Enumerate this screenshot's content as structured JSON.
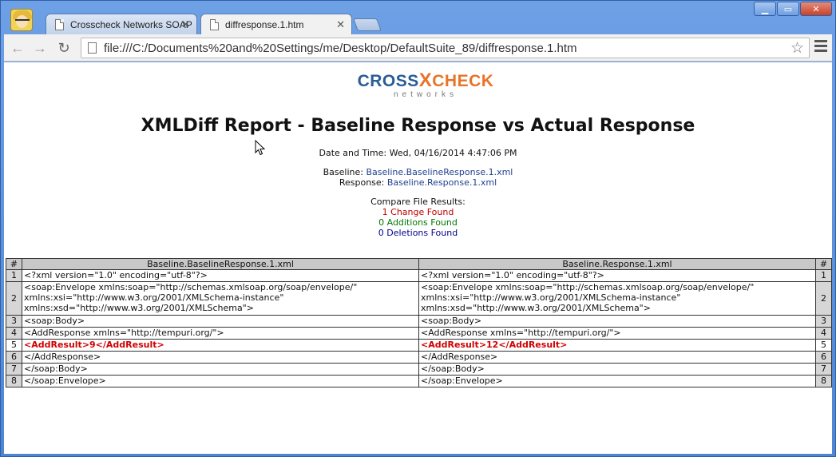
{
  "tabs": [
    {
      "label": "Crosscheck Networks SOAP",
      "active": false
    },
    {
      "label": "diffresponse.1.htm",
      "active": true
    }
  ],
  "address": "file:///C:/Documents%20and%20Settings/me/Desktop/DefaultSuite_89/diffresponse.1.htm",
  "logo": {
    "part1": "CROSS",
    "part2": "X",
    "part3": "CHECK",
    "sub": "networks"
  },
  "report": {
    "title": "XMLDiff Report - Baseline Response vs Actual Response",
    "datetime": "Date and Time: Wed, 04/16/2014 4:47:06 PM",
    "baseline_label": "Baseline:",
    "baseline_file": "Baseline.BaselineResponse.1.xml",
    "response_label": "Response:",
    "response_file": "Baseline.Response.1.xml",
    "results_label": "Compare File Results:",
    "changes": "1 Change Found",
    "additions": "0 Additions Found",
    "deletions": "0 Deletions Found"
  },
  "table": {
    "hash": "#",
    "left_header": "Baseline.BaselineResponse.1.xml",
    "right_header": "Baseline.Response.1.xml",
    "rows": [
      {
        "n": "1",
        "left": "<?xml version=\"1.0\" encoding=\"utf-8\"?>",
        "right": "<?xml version=\"1.0\" encoding=\"utf-8\"?>"
      },
      {
        "n": "2",
        "left_lines": [
          "<soap:Envelope xmlns:soap=\"http://schemas.xmlsoap.org/soap/envelope/\"",
          "xmlns:xsi=\"http://www.w3.org/2001/XMLSchema-instance\"",
          "xmlns:xsd=\"http://www.w3.org/2001/XMLSchema\">"
        ],
        "right_lines": [
          "<soap:Envelope xmlns:soap=\"http://schemas.xmlsoap.org/soap/envelope/\"",
          "xmlns:xsi=\"http://www.w3.org/2001/XMLSchema-instance\"",
          "xmlns:xsd=\"http://www.w3.org/2001/XMLSchema\">"
        ]
      },
      {
        "n": "3",
        "left": "<soap:Body>",
        "right": "<soap:Body>"
      },
      {
        "n": "4",
        "left": "<AddResponse xmlns=\"http://tempuri.org/\">",
        "right": "<AddResponse xmlns=\"http://tempuri.org/\">"
      },
      {
        "n": "5",
        "left": "<AddResult>9</AddResult>",
        "right": "<AddResult>12</AddResult>",
        "changed": true
      },
      {
        "n": "6",
        "left": "</AddResponse>",
        "right": "</AddResponse>"
      },
      {
        "n": "7",
        "left": "</soap:Body>",
        "right": "</soap:Body>"
      },
      {
        "n": "8",
        "left": "</soap:Envelope>",
        "right": "</soap:Envelope>"
      }
    ]
  },
  "colors": {
    "change": "#c00000",
    "addition": "#007700",
    "deletion": "#00008b",
    "link": "#1f3f8f"
  }
}
